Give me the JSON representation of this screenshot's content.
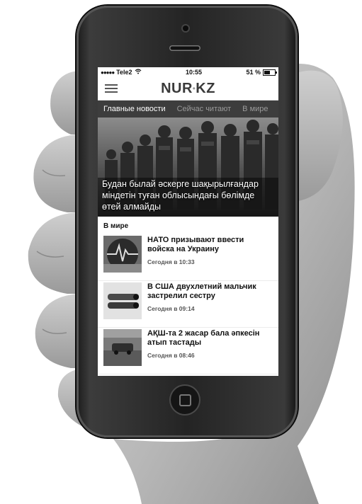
{
  "status_bar": {
    "carrier": "Tele2",
    "time": "10:55",
    "battery": "51 %"
  },
  "app": {
    "logo_left": "NUR",
    "logo_sep": "•",
    "logo_right": "KZ"
  },
  "tabs": [
    {
      "label": "Главные новости",
      "active": true
    },
    {
      "label": "Сейчас читают",
      "active": false
    },
    {
      "label": "В мире",
      "active": false
    }
  ],
  "hero": {
    "caption": "Будан былай әскерге шақырылғандар міндетін туған облысындағы бөлімде өтей алмайды"
  },
  "section": {
    "title": "В мире"
  },
  "news": [
    {
      "title": "НАТО призывают ввести войска на Украину",
      "time": "Сегодня в 10:33"
    },
    {
      "title": "В США двухлетний мальчик застрелил сестру",
      "time": "Сегодня в 09:14"
    },
    {
      "title": "АҚШ-та 2 жасар бала әпкесін атып тастады",
      "time": "Сегодня в 08:46"
    }
  ]
}
